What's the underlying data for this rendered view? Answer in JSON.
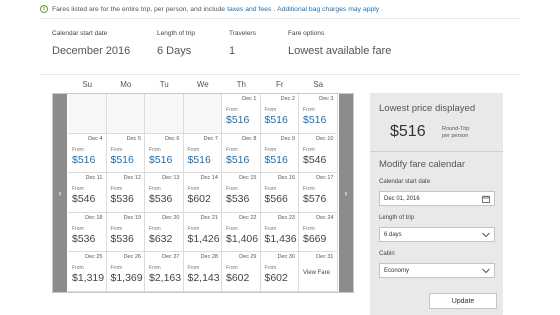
{
  "notice": {
    "text1": "Fares listed are for the entire trip",
    "text2": ", per person, and include",
    "link1": "taxes and fees",
    "text3": ".",
    "link2": "Additional bag charges may apply",
    "text4": "."
  },
  "filters": [
    {
      "label": "Calendar start date",
      "value": "December 2016"
    },
    {
      "label": "Length of trip",
      "value": "6 Days"
    },
    {
      "label": "Travelers",
      "value": "1"
    },
    {
      "label": "Fare options",
      "value": "Lowest available fare"
    }
  ],
  "days": [
    "Su",
    "Mo",
    "Tu",
    "We",
    "Th",
    "Fr",
    "Sa"
  ],
  "calendar": {
    "from_label": "From",
    "weeks": [
      [
        null,
        null,
        null,
        null,
        {
          "date": "Dec 1",
          "price": "$516",
          "lowest": true
        },
        {
          "date": "Dec 2",
          "price": "$516",
          "lowest": true
        },
        {
          "date": "Dec 3",
          "price": "$516",
          "lowest": true
        }
      ],
      [
        {
          "date": "Dec 4",
          "price": "$516",
          "lowest": true
        },
        {
          "date": "Dec 5",
          "price": "$516",
          "lowest": true
        },
        {
          "date": "Dec 6",
          "price": "$516",
          "lowest": true
        },
        {
          "date": "Dec 7",
          "price": "$516",
          "lowest": true
        },
        {
          "date": "Dec 8",
          "price": "$516",
          "lowest": true
        },
        {
          "date": "Dec 9",
          "price": "$516",
          "lowest": true
        },
        {
          "date": "Dec 10",
          "price": "$546",
          "lowest": false
        }
      ],
      [
        {
          "date": "Dec 11",
          "price": "$546",
          "lowest": false
        },
        {
          "date": "Dec 12",
          "price": "$536",
          "lowest": false
        },
        {
          "date": "Dec 13",
          "price": "$536",
          "lowest": false
        },
        {
          "date": "Dec 14",
          "price": "$602",
          "lowest": false
        },
        {
          "date": "Dec 15",
          "price": "$536",
          "lowest": false
        },
        {
          "date": "Dec 16",
          "price": "$566",
          "lowest": false
        },
        {
          "date": "Dec 17",
          "price": "$576",
          "lowest": false
        }
      ],
      [
        {
          "date": "Dec 18",
          "price": "$536",
          "lowest": false
        },
        {
          "date": "Dec 19",
          "price": "$536",
          "lowest": false
        },
        {
          "date": "Dec 20",
          "price": "$632",
          "lowest": false
        },
        {
          "date": "Dec 21",
          "price": "$1,426",
          "lowest": false
        },
        {
          "date": "Dec 22",
          "price": "$1,406",
          "lowest": false
        },
        {
          "date": "Dec 23",
          "price": "$1,436",
          "lowest": false
        },
        {
          "date": "Dec 24",
          "price": "$669",
          "lowest": false
        }
      ],
      [
        {
          "date": "Dec 25",
          "price": "$1,319",
          "lowest": false
        },
        {
          "date": "Dec 26",
          "price": "$1,369",
          "lowest": false
        },
        {
          "date": "Dec 27",
          "price": "$2,163",
          "lowest": false
        },
        {
          "date": "Dec 28",
          "price": "$2,143",
          "lowest": false
        },
        {
          "date": "Dec 29",
          "price": "$602",
          "lowest": false
        },
        {
          "date": "Dec 30",
          "price": "$602",
          "lowest": false
        },
        {
          "date": "Dec 31",
          "view": "View Fare"
        }
      ]
    ]
  },
  "panel": {
    "lowest_title": "Lowest price displayed",
    "lowest_price": "$516",
    "rt_line1": "Round-Trip",
    "rt_line2": "per person",
    "modify_title": "Modify fare calendar",
    "start_label": "Calendar start date",
    "start_value": "Dec 01, 2016",
    "length_label": "Length of trip",
    "length_value": "6 days",
    "cabin_label": "Cabin",
    "cabin_value": "Economy",
    "update_label": "Update"
  },
  "colors": {
    "accent": "#1a6fb5",
    "panel_bg": "#e9e9e9",
    "nav_bg": "#8c8c8c"
  }
}
